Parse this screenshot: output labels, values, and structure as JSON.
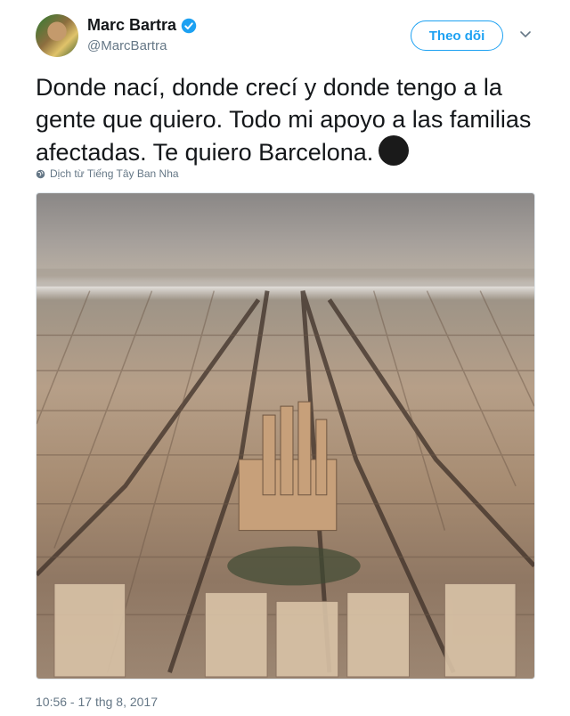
{
  "author": {
    "name": "Marc Bartra",
    "handle": "@MarcBartra",
    "avatar_icon": "avatar-photo",
    "verified_icon": "verified-badge-icon",
    "verified_color": "#1da1f2"
  },
  "actions": {
    "follow_label": "Theo dõi",
    "more_icon": "chevron-down-icon"
  },
  "tweet": {
    "text": "Donde nací, donde crecí y donde tengo a la gente que quiero. Todo mi apoyo a las familias afectadas. Te quiero Barcelona.",
    "emoji_icon": "black-heart-icon",
    "translate_label": "Dịch từ Tiếng Tây Ban Nha",
    "translate_icon": "globe-icon",
    "image_icon": "barcelona-aerial-photo",
    "timestamp": "10:56 - 17 thg 8, 2017"
  },
  "colors": {
    "accent": "#1da1f2",
    "secondary_text": "#657786",
    "primary_text": "#14171a"
  }
}
